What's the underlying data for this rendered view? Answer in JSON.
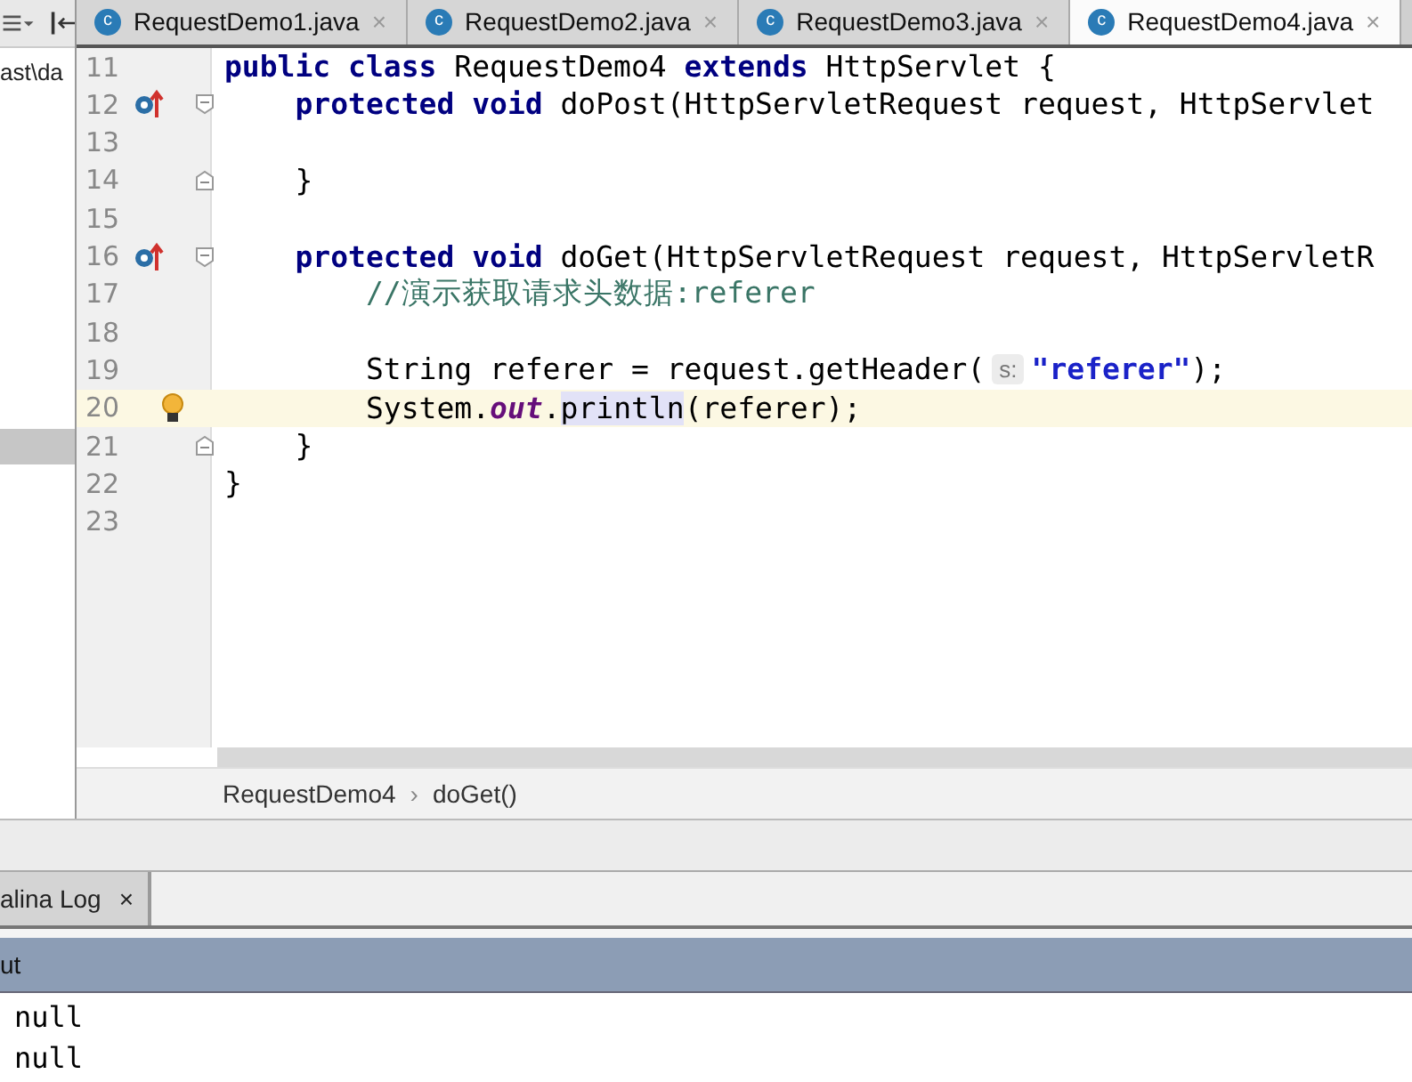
{
  "project_panel": {
    "path_fragment": "ast\\da"
  },
  "tabs": [
    {
      "icon": "c",
      "label": "RequestDemo1.java",
      "close": "×",
      "selected": false
    },
    {
      "icon": "c",
      "label": "RequestDemo2.java",
      "close": "×",
      "selected": false
    },
    {
      "icon": "c",
      "label": "RequestDemo3.java",
      "close": "×",
      "selected": false
    },
    {
      "icon": "c",
      "label": "RequestDemo4.java",
      "close": "×",
      "selected": true
    }
  ],
  "editor": {
    "lines": [
      {
        "number": "11",
        "highlighted": false,
        "segments": [
          {
            "kind": "keyword",
            "text": "public class"
          },
          {
            "kind": "plain",
            "text": " RequestDemo4 "
          },
          {
            "kind": "keyword",
            "text": "extends"
          },
          {
            "kind": "plain",
            "text": " HttpServlet {"
          }
        ]
      },
      {
        "number": "12",
        "gutter_icon": {
          "kind": "override"
        },
        "fold_marker": {
          "kind": "start"
        },
        "highlighted": false,
        "segments": [
          {
            "kind": "keyword",
            "text": "    protected void"
          },
          {
            "kind": "plain",
            "text": " doPost(HttpServletRequest request, HttpServlet"
          }
        ]
      },
      {
        "number": "13",
        "highlighted": false
      },
      {
        "number": "14",
        "fold_marker": {
          "kind": "end"
        },
        "highlighted": false,
        "segments": [
          {
            "kind": "plain",
            "text": "    }"
          }
        ]
      },
      {
        "number": "15",
        "highlighted": false
      },
      {
        "number": "16",
        "gutter_icon": {
          "kind": "override"
        },
        "fold_marker": {
          "kind": "start"
        },
        "highlighted": false,
        "segments": [
          {
            "kind": "keyword",
            "text": "    protected void"
          },
          {
            "kind": "plain",
            "text": " doGet(HttpServletRequest request, HttpServletR"
          }
        ]
      },
      {
        "number": "17",
        "highlighted": false,
        "segments": [
          {
            "kind": "comment",
            "text": "        //演示获取请求头数据:referer"
          }
        ]
      },
      {
        "number": "18",
        "highlighted": false
      },
      {
        "number": "19",
        "highlighted": false,
        "segments": [
          {
            "kind": "plain",
            "text": "        String referer = request.getHeader("
          },
          {
            "kind": "hint",
            "text": "s:"
          },
          {
            "kind": "string",
            "text": "\"referer\""
          },
          {
            "kind": "plain",
            "text": ");"
          }
        ]
      },
      {
        "number": "20",
        "gutter_icon": {
          "kind": "bulb"
        },
        "highlighted": true,
        "segments": [
          {
            "kind": "plain",
            "text": "        System."
          },
          {
            "kind": "static",
            "text": "out"
          },
          {
            "kind": "plain",
            "text": "."
          },
          {
            "kind": "usage",
            "text": "println"
          },
          {
            "kind": "plain",
            "text": "(referer);"
          }
        ]
      },
      {
        "number": "21",
        "fold_marker": {
          "kind": "end"
        },
        "highlighted": false,
        "segments": [
          {
            "kind": "plain",
            "text": "    }"
          }
        ]
      },
      {
        "number": "22",
        "highlighted": false,
        "segments": [
          {
            "kind": "plain",
            "text": "}"
          }
        ]
      },
      {
        "number": "23",
        "highlighted": false
      }
    ]
  },
  "breadcrumb": {
    "items": [
      "RequestDemo4",
      "doGet()"
    ],
    "separator": "›"
  },
  "tool_tabs": [
    {
      "label": "alina Log",
      "close": "×"
    }
  ],
  "output": {
    "title": "ut",
    "lines": [
      "null",
      "null"
    ]
  }
}
